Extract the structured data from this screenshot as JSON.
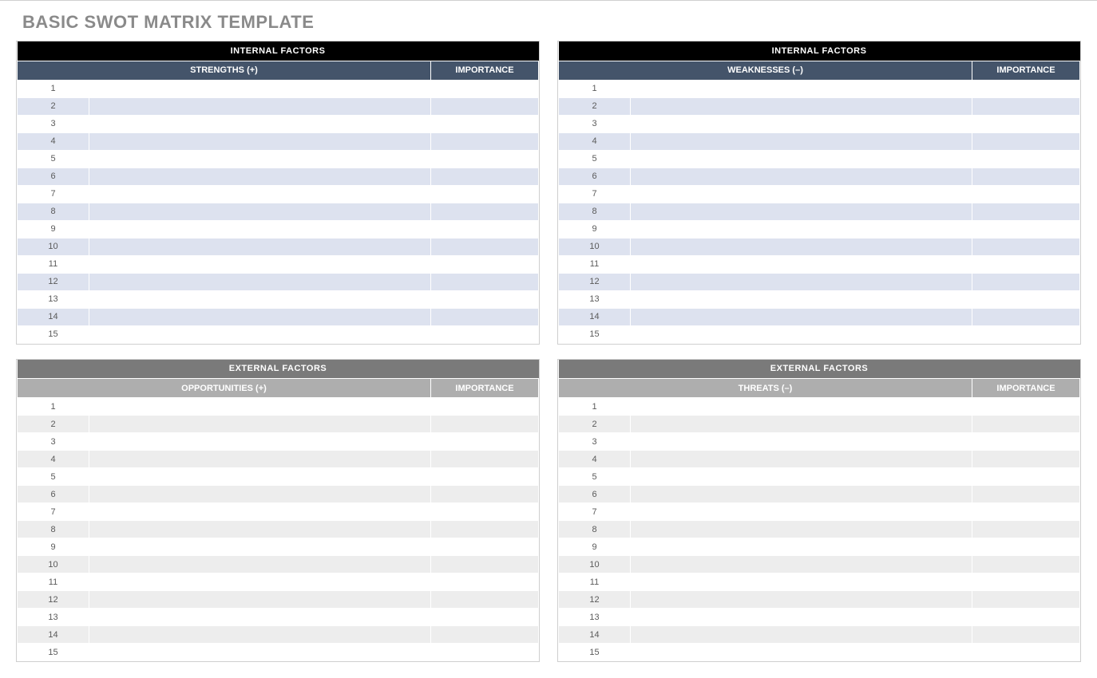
{
  "title": "BASIC SWOT MATRIX TEMPLATE",
  "quadrants": [
    {
      "id": "strengths",
      "section": "internal",
      "factor_header": "INTERNAL FACTORS",
      "col_label": "STRENGTHS (+)",
      "importance_label": "IMPORTANCE",
      "rows": [
        "1",
        "2",
        "3",
        "4",
        "5",
        "6",
        "7",
        "8",
        "9",
        "10",
        "11",
        "12",
        "13",
        "14",
        "15"
      ]
    },
    {
      "id": "weaknesses",
      "section": "internal",
      "factor_header": "INTERNAL FACTORS",
      "col_label": "WEAKNESSES (–)",
      "importance_label": "IMPORTANCE",
      "rows": [
        "1",
        "2",
        "3",
        "4",
        "5",
        "6",
        "7",
        "8",
        "9",
        "10",
        "11",
        "12",
        "13",
        "14",
        "15"
      ]
    },
    {
      "id": "opportunities",
      "section": "external",
      "factor_header": "EXTERNAL FACTORS",
      "col_label": "OPPORTUNITIES (+)",
      "importance_label": "IMPORTANCE",
      "rows": [
        "1",
        "2",
        "3",
        "4",
        "5",
        "6",
        "7",
        "8",
        "9",
        "10",
        "11",
        "12",
        "13",
        "14",
        "15"
      ]
    },
    {
      "id": "threats",
      "section": "external",
      "factor_header": "EXTERNAL FACTORS",
      "col_label": "THREATS (–)",
      "importance_label": "IMPORTANCE",
      "rows": [
        "1",
        "2",
        "3",
        "4",
        "5",
        "6",
        "7",
        "8",
        "9",
        "10",
        "11",
        "12",
        "13",
        "14",
        "15"
      ]
    }
  ]
}
